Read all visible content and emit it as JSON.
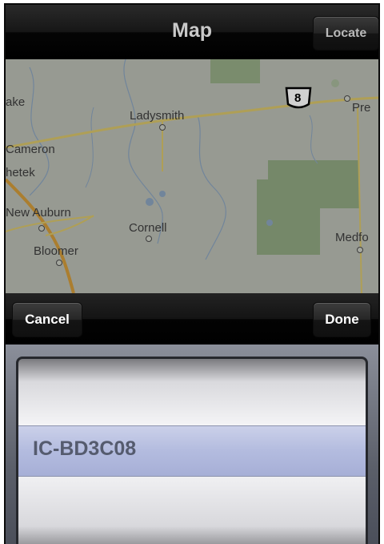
{
  "navbar": {
    "title": "Map",
    "locate_label": "Locate"
  },
  "map": {
    "labels": {
      "ake": "ake",
      "ladysmith": "Ladysmith",
      "cameron": "Cameron",
      "chetek": "hetek",
      "new_auburn": "New Auburn",
      "cornell": "Cornell",
      "bloomer": "Bloomer",
      "prentice": "Pre",
      "medford": "Medfo",
      "highway": "8"
    }
  },
  "toolbar": {
    "cancel_label": "Cancel",
    "done_label": "Done"
  },
  "picker": {
    "selected_item": "IC-BD3C08"
  }
}
